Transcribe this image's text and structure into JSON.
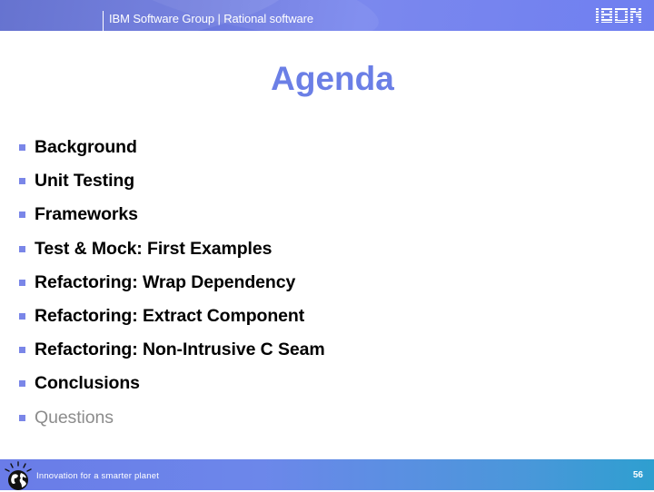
{
  "header": {
    "title": "IBM Software Group | Rational software",
    "logo_text": "IBM"
  },
  "slide": {
    "title": "Agenda",
    "items": [
      {
        "label": "Background",
        "style": "bold"
      },
      {
        "label": "Unit Testing",
        "style": "bold"
      },
      {
        "label": "Frameworks",
        "style": "bold"
      },
      {
        "label": "Test & Mock: First Examples",
        "style": "bold"
      },
      {
        "label": "Refactoring: Wrap Dependency",
        "style": "bold"
      },
      {
        "label": "Refactoring: Extract Component",
        "style": "bold"
      },
      {
        "label": "Refactoring: Non-Intrusive C Seam",
        "style": "bold"
      },
      {
        "label": "Conclusions",
        "style": "bold"
      },
      {
        "label": "Questions",
        "style": "dimmed"
      }
    ]
  },
  "footer": {
    "tagline": "Innovation for a smarter planet",
    "page_number": "56",
    "icon": "smarter-planet-globe-icon"
  },
  "colors": {
    "title": "#6b7fe6",
    "bullet": "#7a86e8",
    "dimmed_text": "#8c8c8c",
    "header_bg": "#6a77dd",
    "footer_bg_start": "#6a7ce8",
    "footer_bg_end": "#2e9fd0"
  }
}
